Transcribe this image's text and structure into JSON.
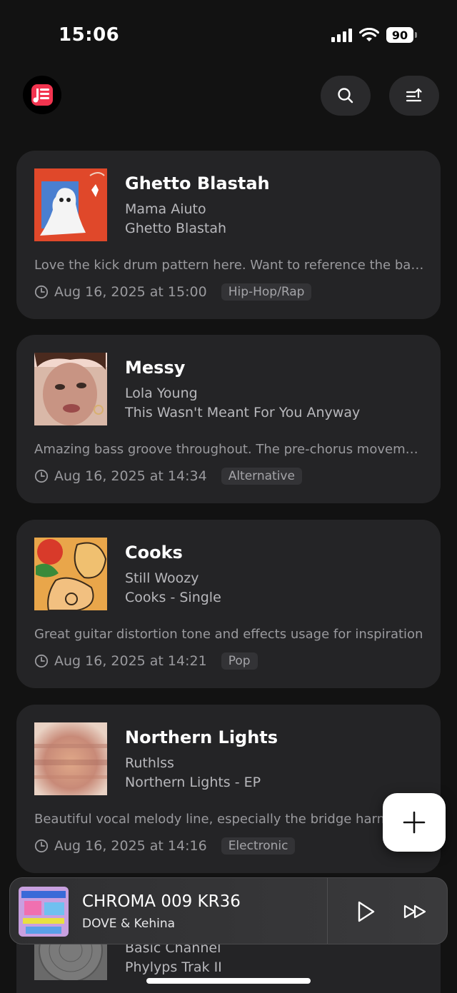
{
  "status_bar": {
    "time": "15:06",
    "battery": "90"
  },
  "header": {
    "logo_icon": "music-note-app-icon",
    "search_icon": "search-icon",
    "sort_icon": "sort-icon"
  },
  "songs": [
    {
      "title": "Ghetto Blastah",
      "artist": "Mama Aiuto",
      "album": "Ghetto Blastah",
      "note": "Love the kick drum pattern here. Want to reference the bass and drum interplay",
      "date": "Aug 16, 2025 at 15:00",
      "genre": "Hip-Hop/Rap"
    },
    {
      "title": "Messy",
      "artist": "Lola Young",
      "album": "This Wasn't Meant For You Anyway",
      "note": "Amazing bass groove throughout. The pre-chorus movement is great",
      "date": "Aug 16, 2025 at 14:34",
      "genre": "Alternative"
    },
    {
      "title": "Cooks",
      "artist": "Still Woozy",
      "album": "Cooks - Single",
      "note": "Great guitar distortion tone and effects usage for inspiration",
      "date": "Aug 16, 2025 at 14:21",
      "genre": "Pop"
    },
    {
      "title": "Northern Lights",
      "artist": "Ruthlss",
      "album": "Northern Lights - EP",
      "note": "Beautiful vocal melody line, especially the bridge harmonies",
      "date": "Aug 16, 2025 at 14:16",
      "genre": "Electronic"
    },
    {
      "title": "",
      "artist": "Basic Channel",
      "album": "Phylyps Trak II",
      "note": "",
      "date": "",
      "genre": ""
    }
  ],
  "fab": {
    "icon": "plus-icon"
  },
  "now_playing": {
    "title": "CHROMA 009 KR36",
    "artist": "DOVE & Kehina",
    "play_icon": "play-icon",
    "skip_icon": "fast-forward-icon"
  }
}
